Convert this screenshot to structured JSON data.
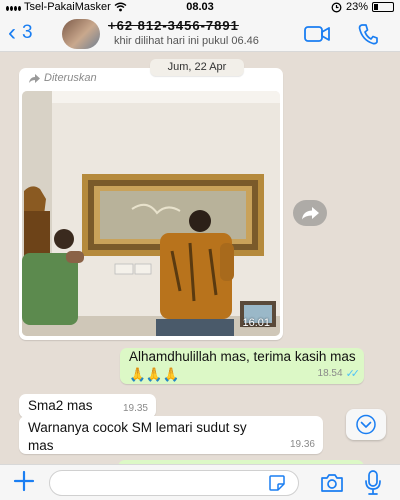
{
  "status_bar": {
    "carrier": "Tsel-PakaiMasker",
    "time": "08.03",
    "battery": "23%",
    "battery_level": 0.23
  },
  "header": {
    "back_count": "3",
    "contact_name": "+62 812-3456-7891",
    "last_seen": "khir dilihat hari ini pukul 06.46"
  },
  "chat": {
    "date": "Jum, 22 Apr",
    "forwarded_label": "Diteruskan",
    "image_time": "16.01",
    "messages": [
      {
        "direction": "out",
        "text": "Alhamdhulillah mas, terima kasih mas🙏🙏🙏",
        "time": "18.54",
        "status": "read"
      },
      {
        "direction": "in",
        "text": "Sma2 mas",
        "time": "19.35"
      },
      {
        "direction": "in",
        "text": "Warnanya cocok SM lemari sudut sy mas",
        "time": "19.36"
      }
    ]
  },
  "input": {
    "placeholder": ""
  },
  "colors": {
    "accent": "#1a7ef2",
    "outgoing_bubble": "#dcf8c6",
    "incoming_bubble": "#ffffff",
    "chat_background": "#e5ddd5",
    "read_ticks": "#4fc3f7"
  },
  "icons": [
    "wifi-icon",
    "alarm-icon",
    "battery-icon",
    "back-chevron-icon",
    "video-call-icon",
    "phone-icon",
    "forward-icon",
    "scroll-down-icon",
    "plus-icon",
    "sticker-icon",
    "camera-icon",
    "mic-icon"
  ]
}
